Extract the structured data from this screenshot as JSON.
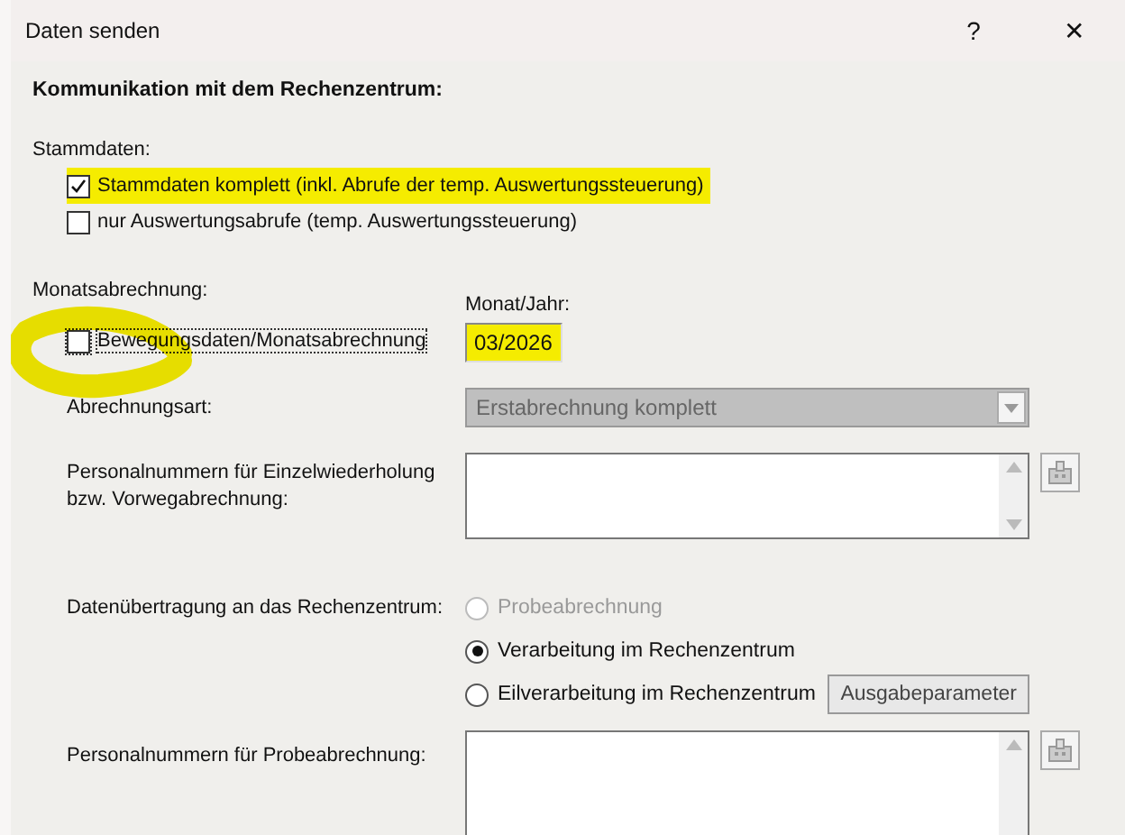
{
  "window": {
    "title": "Daten senden",
    "help": "?",
    "close": "✕"
  },
  "heading": "Kommunikation mit dem Rechenzentrum:",
  "stammdaten": {
    "label": "Stammdaten:",
    "options": [
      {
        "label": "Stammdaten komplett (inkl. Abrufe der temp. Auswertungssteuerung)",
        "checked": true,
        "highlighted": true
      },
      {
        "label": "nur Auswertungsabrufe (temp. Auswertungssteuerung)",
        "checked": false,
        "highlighted": false
      }
    ]
  },
  "monatsabrechnung": {
    "label": "Monatsabrechnung:",
    "checkbox": {
      "label": "Bewegungsdaten/Monatsabrechnung",
      "checked": false,
      "focused": true,
      "circled": true
    },
    "month": {
      "label": "Monat/Jahr:",
      "value": "03/2026",
      "highlighted": true
    }
  },
  "abrechnungsart": {
    "label": "Abrechnungsart:",
    "value": "Erstabrechnung komplett",
    "disabled": true
  },
  "einzelwiederholung": {
    "label": "Personalnummern für Einzelwiederholung bzw. Vorwegabrechnung:"
  },
  "datenuebertragung": {
    "label": "Datenübertragung an das Rechenzentrum:",
    "options": [
      {
        "label": "Probeabrechnung",
        "selected": false,
        "disabled": true
      },
      {
        "label": "Verarbeitung im Rechenzentrum",
        "selected": true,
        "disabled": false
      },
      {
        "label": "Eilverarbeitung im Rechenzentrum",
        "selected": false,
        "disabled": false
      }
    ],
    "button": "Ausgabeparameter"
  },
  "probeabrechnung": {
    "label": "Personalnummern für Probeabrechnung:"
  }
}
